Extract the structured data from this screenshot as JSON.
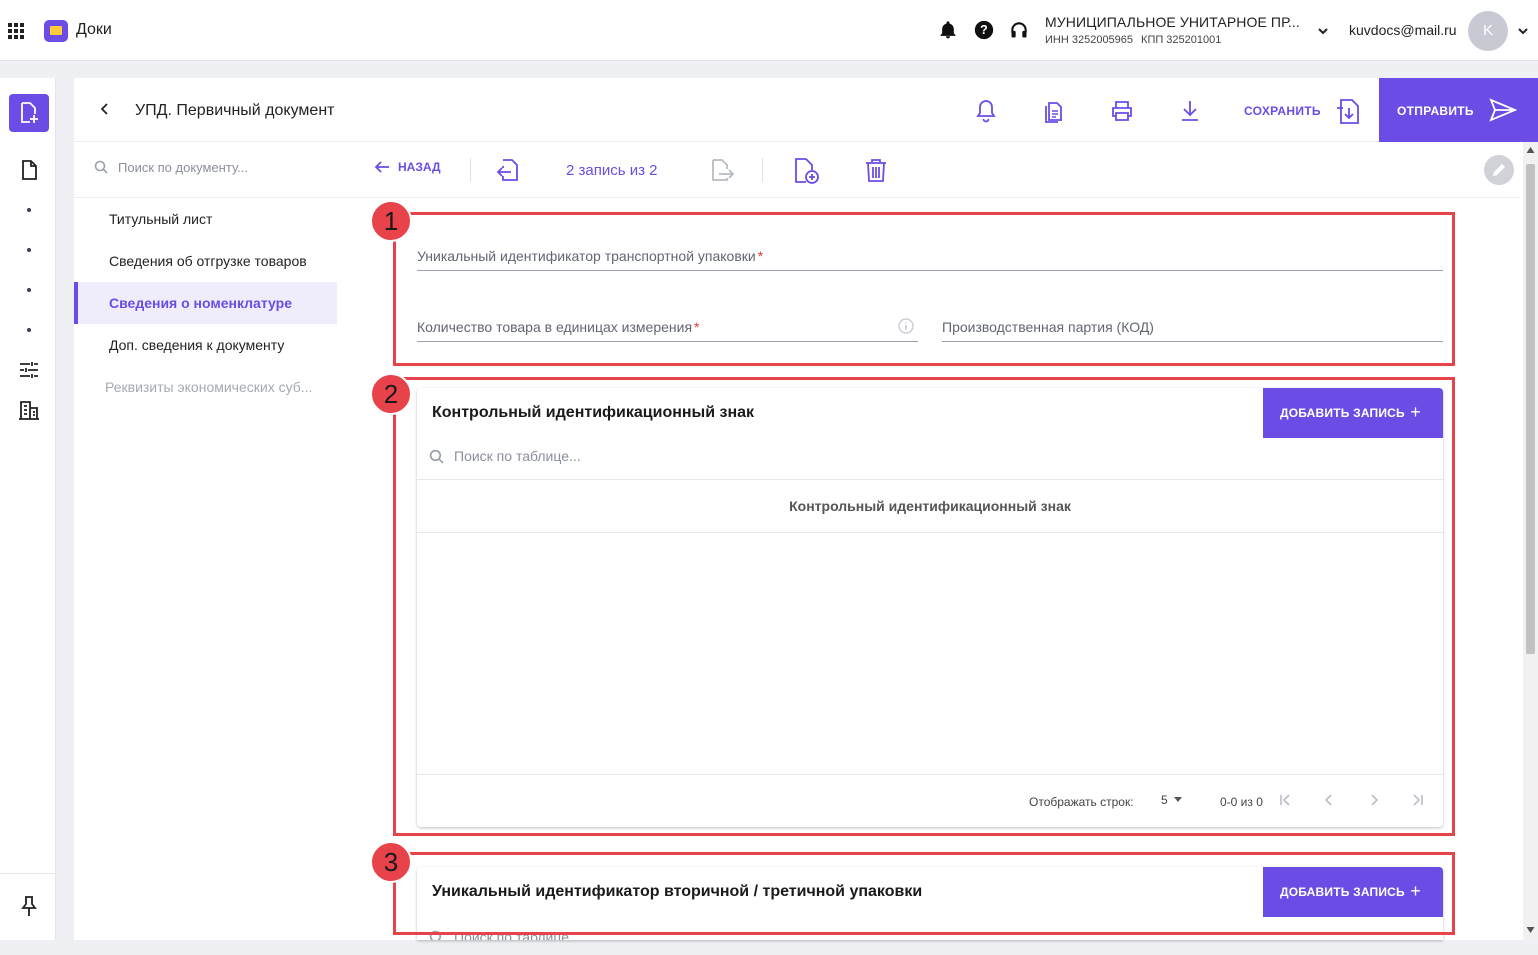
{
  "topbar": {
    "app_name": "Доки",
    "org_name": "МУНИЦИПАЛЬНОЕ УНИТАРНОЕ ПР...",
    "inn": "ИНН 3252005965",
    "kpp": "КПП 325201001",
    "email": "kuvdocs@mail.ru",
    "avatar_letter": "K"
  },
  "header": {
    "title": "УПД. Первичный документ",
    "save_label": "СОХРАНИТЬ",
    "send_label": "ОТПРАВИТЬ"
  },
  "toolbar": {
    "search_placeholder": "Поиск по документу...",
    "back_label": "НАЗАД",
    "record_counter": "2 запись из 2"
  },
  "sidebar": {
    "items": [
      {
        "label": "Титульный лист",
        "state": "normal"
      },
      {
        "label": "Сведения об отгрузке товаров",
        "state": "normal"
      },
      {
        "label": "Сведения о номенклатуре",
        "state": "active"
      },
      {
        "label": "Доп. сведения к документу",
        "state": "normal"
      },
      {
        "label": "Реквизиты экономических суб...",
        "state": "disabled"
      }
    ]
  },
  "form": {
    "transport_id_label": "Уникальный идентификатор транспортной упаковки",
    "quantity_label": "Количество товара в единицах измерения",
    "batch_label": "Производственная партия (КОД)",
    "required_mark": "*"
  },
  "kiz_table": {
    "title": "Контрольный идентификационный знак",
    "add_label": "ДОБАВИТЬ ЗАПИСЬ",
    "search_placeholder": "Поиск по таблице...",
    "column_header": "Контрольный идентификационный знак",
    "rows_label": "Отображать строк:",
    "rows_value": "5",
    "range": "0-0 из 0"
  },
  "packaging_table": {
    "title": "Уникальный идентификатор вторичной / третичной упаковки",
    "add_label": "ДОБАВИТЬ ЗАПИСЬ",
    "search_placeholder": "Поиск по таблице..."
  },
  "annotations": {
    "badge_1": "1",
    "badge_2": "2",
    "badge_3": "3"
  },
  "colors": {
    "accent": "#6b4de6",
    "highlight": "#e8424a",
    "required": "#e53935"
  },
  "icons": [
    "apps-grid-icon",
    "folder-icon",
    "bell-icon",
    "help-icon",
    "headset-icon",
    "chevron-down-icon",
    "file-plus-icon",
    "document-icon",
    "filter-list-icon",
    "building-icon",
    "pin-icon",
    "back-chevron-icon",
    "copy-docs-icon",
    "print-icon",
    "download-icon",
    "save-file-icon",
    "send-icon",
    "search-icon",
    "arrow-left-icon",
    "prev-record-icon",
    "next-record-icon",
    "add-record-icon",
    "trash-icon",
    "pencil-icon",
    "info-icon",
    "first-page-icon",
    "prev-page-icon",
    "next-page-icon",
    "last-page-icon"
  ]
}
